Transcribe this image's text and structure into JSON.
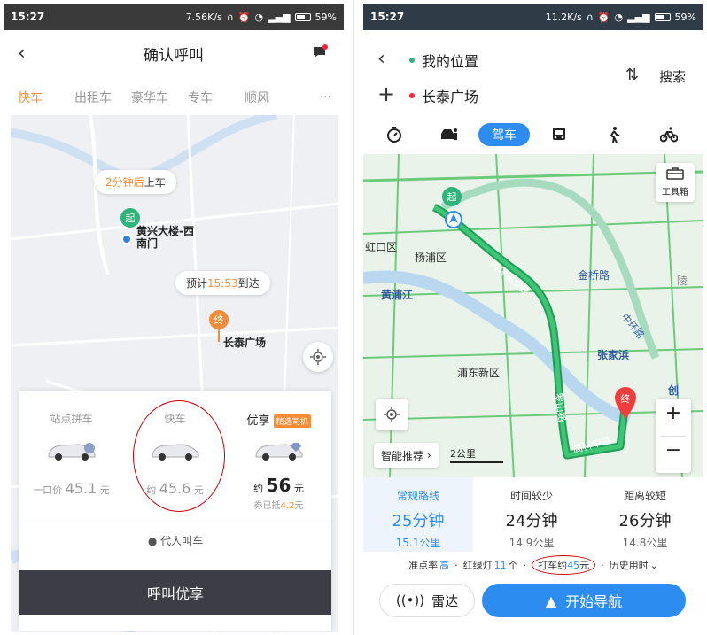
{
  "left": {
    "status": {
      "time": "15:27",
      "speed": "7.56K/s",
      "battery": "59%",
      "battery_level": 0.59
    },
    "header": {
      "title": "确认呼叫"
    },
    "tabs": [
      {
        "label": "快车",
        "active": true
      },
      {
        "label": "出租车",
        "active": false
      },
      {
        "label": "豪华车",
        "active": false
      },
      {
        "label": "专车",
        "active": false
      },
      {
        "label": "顺风",
        "active": false
      }
    ],
    "tabs_more": "···",
    "map": {
      "pickup_bubble": {
        "highlight": "2分钟后",
        "text": "上车"
      },
      "start_pin": "起",
      "start_label_line1": "黄兴大楼-西",
      "start_label_line2": "南门",
      "eta_bubble": {
        "prefix": "预计",
        "time": "15:53",
        "suffix": "到达"
      },
      "end_pin": "终",
      "end_label": "长泰广场"
    },
    "options": [
      {
        "name": "站点拼车",
        "price_prefix": "一口价",
        "price": "45.1",
        "unit": "元"
      },
      {
        "name": "快车",
        "price_prefix": "约",
        "price": "45.6",
        "unit": "元"
      },
      {
        "name": "优享",
        "tag": "精选司机",
        "price_prefix": "约",
        "price": "56",
        "unit": "元",
        "sub_prefix": "券已抵",
        "sub_amount": "4.2",
        "sub_suffix": "元"
      }
    ],
    "proxy_call": "代人叫车",
    "call_button": "呼叫优享"
  },
  "right": {
    "status": {
      "time": "15:27",
      "speed": "11.2K/s",
      "battery": "59%",
      "battery_level": 0.59
    },
    "from": "我的位置",
    "to": "长泰广场",
    "search": "搜索",
    "modes": {
      "active": "驾车"
    },
    "map": {
      "labels": {
        "hongkou": "虹口区",
        "yangpu": "杨浦区",
        "huangpu_river": "黄浦江",
        "pudong": "浦东新区",
        "jinqiao": "金桥路",
        "zhangjiabang": "张家浜",
        "inner_ring": "内环高架路",
        "luoshan": "罗山路",
        "gaoke": "高科中路",
        "zhongjiang": "中环路",
        "ling": "陵",
        "chuang": "创"
      },
      "start_pin": "起",
      "end_pin": "终",
      "toolbox": "工具箱",
      "smart": "智能推荐",
      "scale": "2公里"
    },
    "routes": [
      {
        "title": "常规路线",
        "time": "25分钟",
        "dist": "15.1公里",
        "active": true
      },
      {
        "title": "时间较少",
        "time": "24分钟",
        "dist": "14.9公里",
        "active": false
      },
      {
        "title": "距离较短",
        "time": "26分钟",
        "dist": "14.8公里",
        "active": false
      }
    ],
    "info": {
      "accuracy_prefix": "准点率",
      "accuracy": "高",
      "lights_prefix": "红绿灯",
      "lights": "11",
      "lights_suffix": "个",
      "taxi_prefix": "打车约",
      "taxi": "45",
      "taxi_suffix": "元",
      "history": "历史用时"
    },
    "radar": "雷达",
    "navigate": "开始导航"
  }
}
